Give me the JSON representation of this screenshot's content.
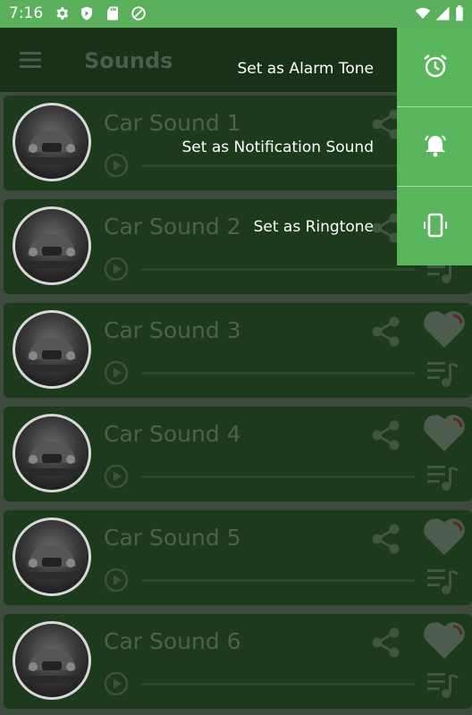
{
  "status_bar": {
    "time": "7:16"
  },
  "app_bar": {
    "title": "Sounds"
  },
  "sounds": [
    {
      "title": "Car Sound 1"
    },
    {
      "title": "Car Sound 2"
    },
    {
      "title": "Car Sound 3"
    },
    {
      "title": "Car Sound 4"
    },
    {
      "title": "Car Sound 5"
    },
    {
      "title": "Car Sound 6"
    }
  ],
  "actions": [
    {
      "label": "Set as Alarm Tone",
      "icon": "alarm-clock-icon"
    },
    {
      "label": "Set as Notification Sound",
      "icon": "bell-ringing-icon"
    },
    {
      "label": "Set as Ringtone",
      "icon": "phone-vibrate-icon"
    }
  ],
  "colors": {
    "status_bar": "#5bb05b",
    "app_bar": "#193119",
    "card": "#1c3a1c",
    "action_menu": "#59b65c"
  }
}
